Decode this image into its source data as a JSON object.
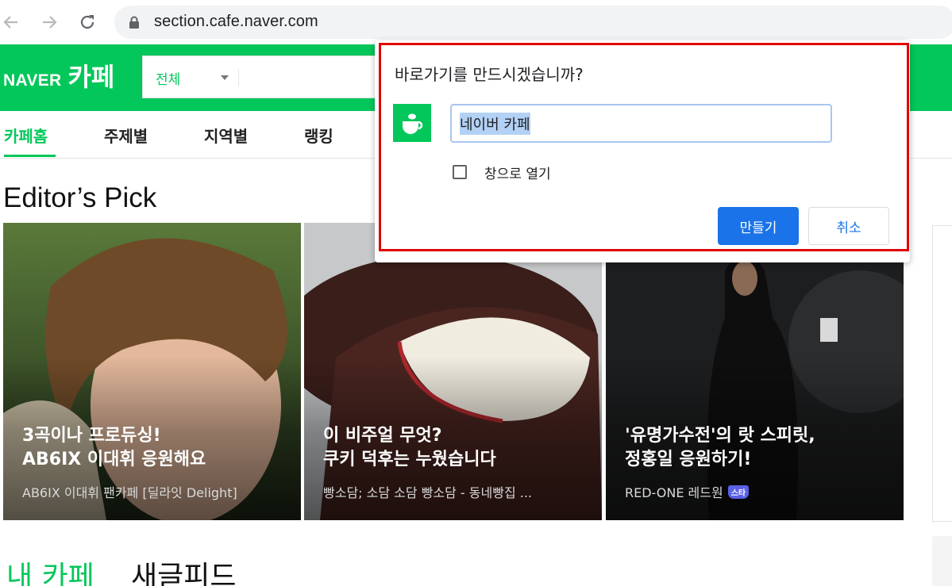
{
  "browser": {
    "url": "section.cafe.naver.com"
  },
  "header": {
    "logo_text": "NAVER",
    "logo_cafe": "카페",
    "search_category": "전체"
  },
  "menu": {
    "items": [
      "카페홈",
      "주제별",
      "지역별",
      "랭킹"
    ],
    "active_index": 0
  },
  "editors_pick": {
    "title": "Editor’s Pick",
    "cards": [
      {
        "title": "3곡이나 프로듀싱!\nAB6IX 이대휘 응원해요",
        "subtitle": "AB6IX 이대휘 팬카페 [딜라잇 Delight]"
      },
      {
        "title": "이 비주얼 무엇?\n쿠키 덕후는 누웠습니다",
        "subtitle": "빵소담; 소담 소담 빵소담 - 동네빵집 ..."
      },
      {
        "title": "'유명가수전'의 랏 스피릿,\n정홍일 응원하기!",
        "subtitle": "RED-ONE 레드원",
        "badge": "스타"
      }
    ]
  },
  "bottom_tabs": {
    "my_cafe": "내 카페",
    "new_feed": "새글피드"
  },
  "dialog": {
    "title": "바로가기를 만드시겠습니까?",
    "name_value": "네이버 카페",
    "open_as_window_label": "창으로 열기",
    "open_as_window_checked": false,
    "create_label": "만들기",
    "cancel_label": "취소"
  },
  "colors": {
    "naver_green": "#03c75a",
    "chrome_blue": "#1a73e8",
    "highlight_red": "#e00000"
  }
}
